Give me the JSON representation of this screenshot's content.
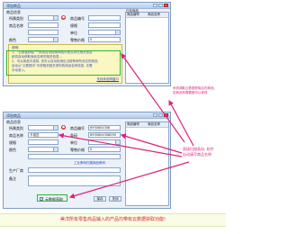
{
  "top_window": {
    "title": "添加商品",
    "group_label": "商品信息",
    "fields": {
      "category_label": "所属类别",
      "code_label": "商品编号",
      "name_label": "商品名称",
      "spec_label": "规格",
      "unit_label": "单位",
      "color_label": "颜色",
      "price_label": "零售价格",
      "price_value": "0"
    },
    "grid_title": "已存商品",
    "grid_headers": [
      "商品编号",
      "商品名称"
    ],
    "notice_title": "说明:",
    "notice_lines": [
      "1、\"云数据获取\"一系统自动检索网络中是否存在相关信息",
      "统将自动获取商品名称的相关信息…",
      "2、可从商品中选择, 也可以自动检测出当前条码所对应的商品",
      "自动从\"云数据中\"中获取到相关资料的商品名称信息, 无需",
      "手动录入。"
    ],
    "close_link": "关闭本说明窗口"
  },
  "bottom_window": {
    "title": "添加商品",
    "group_label": "商品信息",
    "fields": {
      "category_label": "所属类别",
      "category_value": "",
      "code_label": "商品编号",
      "code_value": "6930604308",
      "name_label": "商品名称",
      "name_value": "卡诺迅",
      "spec_label": "规格",
      "unit_label": "单位",
      "color_label": "颜色",
      "price_label": "零售价格",
      "price_value": "0",
      "barcode_label": "条码",
      "barcode_value": "6930604308090",
      "row5_label": "",
      "row6_label": "生产厂商",
      "row7_label": "备注"
    },
    "checkbox_label": "云数据获取",
    "checkbox_checked": true,
    "checkbox_mark": "✓",
    "buttons": {
      "save": "保存",
      "close": "关闭"
    },
    "grid_title": "已存商品",
    "grid_headers": [
      "商品编号",
      "商品名称"
    ],
    "link_text": "工业条码扫描商品条码"
  },
  "callouts": {
    "top_right": [
      "系统调取云数据获取后的商品,",
      "如商品有需要都可以修改"
    ],
    "middle_right": [
      "直接扫描条码, 软件",
      "自动填写商品名称"
    ]
  },
  "bottom_banner": "美洋所有零售商品输入的产品均带有云数据获取功能!",
  "colors": {
    "callout": "#e0217b",
    "banner_text": "#d62525",
    "arrow": "#e0217b",
    "notice_bg": "#fbf7c3",
    "highlight_border": "#2fb82f"
  }
}
